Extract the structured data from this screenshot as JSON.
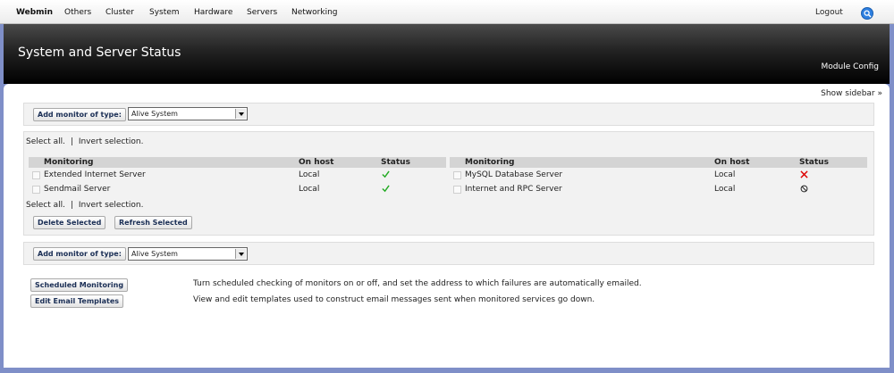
{
  "nav": {
    "items": [
      "Webmin",
      "Others",
      "Cluster",
      "System",
      "Hardware",
      "Servers",
      "Networking"
    ],
    "logout": "Logout"
  },
  "header": {
    "title": "System and Server Status",
    "module_config": "Module Config"
  },
  "show_sidebar": "Show sidebar »",
  "add_monitor": {
    "label": "Add monitor of type:",
    "selected": "Alive System"
  },
  "selection": {
    "select_all": "Select all.",
    "separator": "|",
    "invert": "Invert selection."
  },
  "table": {
    "columns": [
      "Monitoring",
      "On host",
      "Status"
    ],
    "left_rows": [
      {
        "name": "Extended Internet Server",
        "host": "Local",
        "status": "up"
      },
      {
        "name": "Sendmail Server",
        "host": "Local",
        "status": "up"
      }
    ],
    "right_rows": [
      {
        "name": "MySQL Database Server",
        "host": "Local",
        "status": "down"
      },
      {
        "name": "Internet and RPC Server",
        "host": "Local",
        "status": "not-installed"
      }
    ]
  },
  "actions": {
    "delete": "Delete Selected",
    "refresh": "Refresh Selected"
  },
  "bottom": {
    "scheduled_label": "Scheduled Monitoring",
    "scheduled_desc": "Turn scheduled checking of monitors on or off, and set the address to which failures are automatically emailed.",
    "templates_label": "Edit Email Templates",
    "templates_desc": "View and edit templates used to construct email messages sent when monitored services go down."
  },
  "colors": {
    "status_up": "#22aa22",
    "status_down": "#dd0000"
  }
}
